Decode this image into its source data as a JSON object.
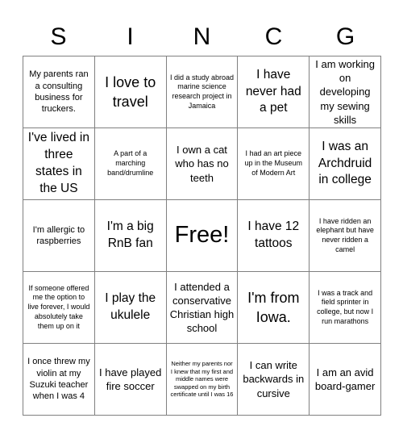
{
  "card": {
    "header_letters": [
      "S",
      "I",
      "N",
      "C",
      "G"
    ],
    "colors": {
      "text": "#000000",
      "grid_line": "#808080",
      "background": "#ffffff"
    },
    "rows": [
      [
        {
          "text": "My parents ran a consulting business for truckers.",
          "size": "sm",
          "free": false
        },
        {
          "text": "I love to travel",
          "size": "xl",
          "free": false
        },
        {
          "text": "I did a study abroad marine science research project in Jamaica",
          "size": "xs",
          "free": false
        },
        {
          "text": "I have never had a pet",
          "size": "lg",
          "free": false
        },
        {
          "text": "I am working on developing my sewing skills",
          "size": "md",
          "free": false
        }
      ],
      [
        {
          "text": "I've lived in three states in the US",
          "size": "lg",
          "free": false
        },
        {
          "text": "A part of a marching band/drumline",
          "size": "xs",
          "free": false
        },
        {
          "text": "I own a cat who has no teeth",
          "size": "md",
          "free": false
        },
        {
          "text": "I had an art piece up in the Museum of Modern Art",
          "size": "xs",
          "free": false
        },
        {
          "text": "I was an Archdruid in college",
          "size": "lg",
          "free": false
        }
      ],
      [
        {
          "text": "I'm allergic to raspberries",
          "size": "sm",
          "free": false
        },
        {
          "text": "I'm a big RnB fan",
          "size": "lg",
          "free": false
        },
        {
          "text": "Free!",
          "size": "free",
          "free": true
        },
        {
          "text": "I have 12 tattoos",
          "size": "lg",
          "free": false
        },
        {
          "text": "I have ridden an elephant but have never ridden a camel",
          "size": "xs",
          "free": false
        }
      ],
      [
        {
          "text": "If someone offered me the option to live forever, I would absolutely take them up on it",
          "size": "xs",
          "free": false
        },
        {
          "text": "I play the ukulele",
          "size": "lg",
          "free": false
        },
        {
          "text": "I attended a conservative Christian high school",
          "size": "md",
          "free": false
        },
        {
          "text": "I'm from Iowa.",
          "size": "xl",
          "free": false
        },
        {
          "text": "I was a track and field sprinter in college, but now I run marathons",
          "size": "xs",
          "free": false
        }
      ],
      [
        {
          "text": "I once threw my violin at my Suzuki teacher when I was 4",
          "size": "sm",
          "free": false
        },
        {
          "text": "I have played fire soccer",
          "size": "md",
          "free": false
        },
        {
          "text": "Neither my parents nor I knew that my first and middle names were swapped on my birth certificate until I was 16",
          "size": "xxs",
          "free": false
        },
        {
          "text": "I can write backwards in cursive",
          "size": "md",
          "free": false
        },
        {
          "text": "I am an avid board-gamer",
          "size": "md",
          "free": false
        }
      ]
    ]
  }
}
